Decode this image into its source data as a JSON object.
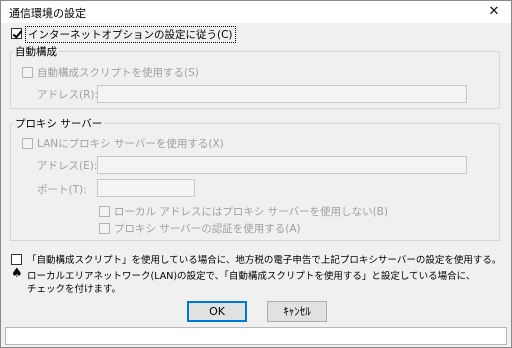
{
  "window": {
    "title": "通信環境の設定",
    "close_glyph": "✕"
  },
  "use_ie_option": {
    "label": "インターネットオプションの設定に従う(C)",
    "checked": true
  },
  "auto_config": {
    "group_title": "自動構成",
    "use_script_label": "自動構成スクリプトを使用する(S)",
    "address_label": "アドレス(R):",
    "address_value": ""
  },
  "proxy_server": {
    "group_title": "プロキシ サーバー",
    "use_proxy_label": "LANにプロキシ サーバーを使用する(X)",
    "address_label": "アドレス(E):",
    "address_value": "",
    "port_label": "ポート(T):",
    "port_value": "",
    "bypass_local_label": "ローカル アドレスにはプロキシ サーバーを使用しない(B)",
    "proxy_auth_label": "プロキシ サーバーの認証を使用する(A)"
  },
  "notice": {
    "checkbox_label": "「自動構成スクリプト」を使用している場合に、地方税の電子申告で上記プロキシサーバーの設定を使用する。",
    "note_line1": "ローカルエリアネットワーク(LAN)の設定で、「自動構成スクリプトを使用する」と設定している場合に、",
    "note_line2": "チェックを付けます。"
  },
  "buttons": {
    "ok": "OK",
    "cancel": "ｷｬﾝｾﾙ"
  },
  "status_bar": {
    "text": ""
  }
}
